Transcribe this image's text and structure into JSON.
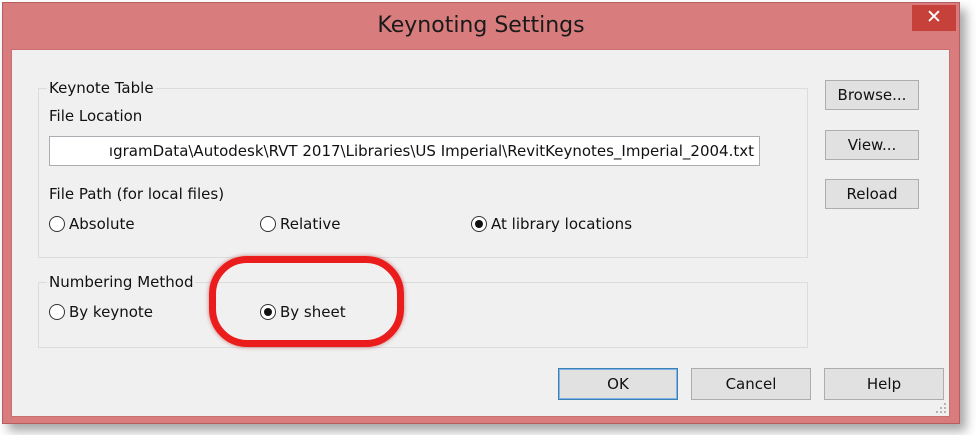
{
  "window": {
    "title": "Keynoting Settings",
    "close_glyph": "✕"
  },
  "keynote_table": {
    "group_title": "Keynote Table",
    "file_location_label": "File Location",
    "file_location_value": "ıgramData\\Autodesk\\RVT 2017\\Libraries\\US Imperial\\RevitKeynotes_Imperial_2004.txt",
    "file_path_label": "File Path (for local files)",
    "options": [
      "Absolute",
      "Relative",
      "At library locations"
    ],
    "selected": "At library locations"
  },
  "numbering_method": {
    "group_title": "Numbering Method",
    "options": [
      "By keynote",
      "By sheet"
    ],
    "selected": "By sheet"
  },
  "side_buttons": {
    "browse": "Browse...",
    "view": "View...",
    "reload": "Reload"
  },
  "footer_buttons": {
    "ok": "OK",
    "cancel": "Cancel",
    "help": "Help"
  },
  "colors": {
    "titlebar": "#d87c7d",
    "close_button": "#c7413b",
    "highlight": "#ea1c1c"
  }
}
